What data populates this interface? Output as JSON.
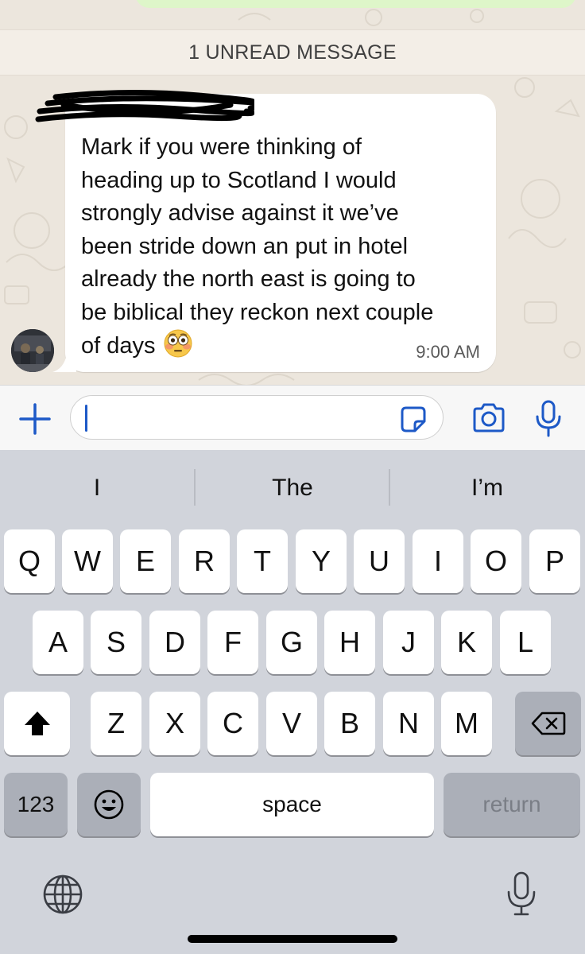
{
  "chat": {
    "unread_banner": "1 UNREAD MESSAGE",
    "message": {
      "text": "Mark if you were thinking of\nheading up to Scotland I would\nstrongly advise against it we’ve\nbeen stride down an put in hotel\nalready the north east is going to\nbe biblical they reckon next couple\nof days",
      "emoji": "flushed-face",
      "time": "9:00 AM"
    }
  },
  "input": {
    "value": ""
  },
  "keyboard": {
    "suggestions": [
      "I",
      "The",
      "I’m"
    ],
    "row1": [
      "Q",
      "W",
      "E",
      "R",
      "T",
      "Y",
      "U",
      "I",
      "O",
      "P"
    ],
    "row2": [
      "A",
      "S",
      "D",
      "F",
      "G",
      "H",
      "J",
      "K",
      "L"
    ],
    "row3": [
      "Z",
      "X",
      "C",
      "V",
      "B",
      "N",
      "M"
    ],
    "numbers_label": "123",
    "space_label": "space",
    "return_label": "return"
  },
  "colors": {
    "accent_blue": "#1d59c7",
    "bubble": "#ffffff",
    "chat_background": "#ece6dd",
    "keyboard_background": "#d1d4db"
  }
}
